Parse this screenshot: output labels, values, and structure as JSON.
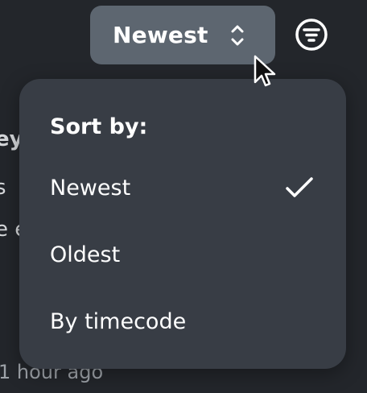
{
  "background": {
    "fragments": [
      "ey",
      "s",
      "e e"
    ],
    "timestamp": "1 hour ago"
  },
  "sort_select": {
    "value": "Newest",
    "icon": "chevron-up-down-icon"
  },
  "filter_button": {
    "icon": "filter-icon"
  },
  "menu": {
    "header": "Sort by:",
    "items": [
      {
        "label": "Newest",
        "selected": true
      },
      {
        "label": "Oldest",
        "selected": false
      },
      {
        "label": "By timecode",
        "selected": false
      }
    ],
    "selected_icon": "checkmark-icon"
  },
  "colors": {
    "background": "#23262b",
    "select_bg": "#5d6670",
    "menu_bg": "#383d45",
    "text": "#ffffff"
  }
}
